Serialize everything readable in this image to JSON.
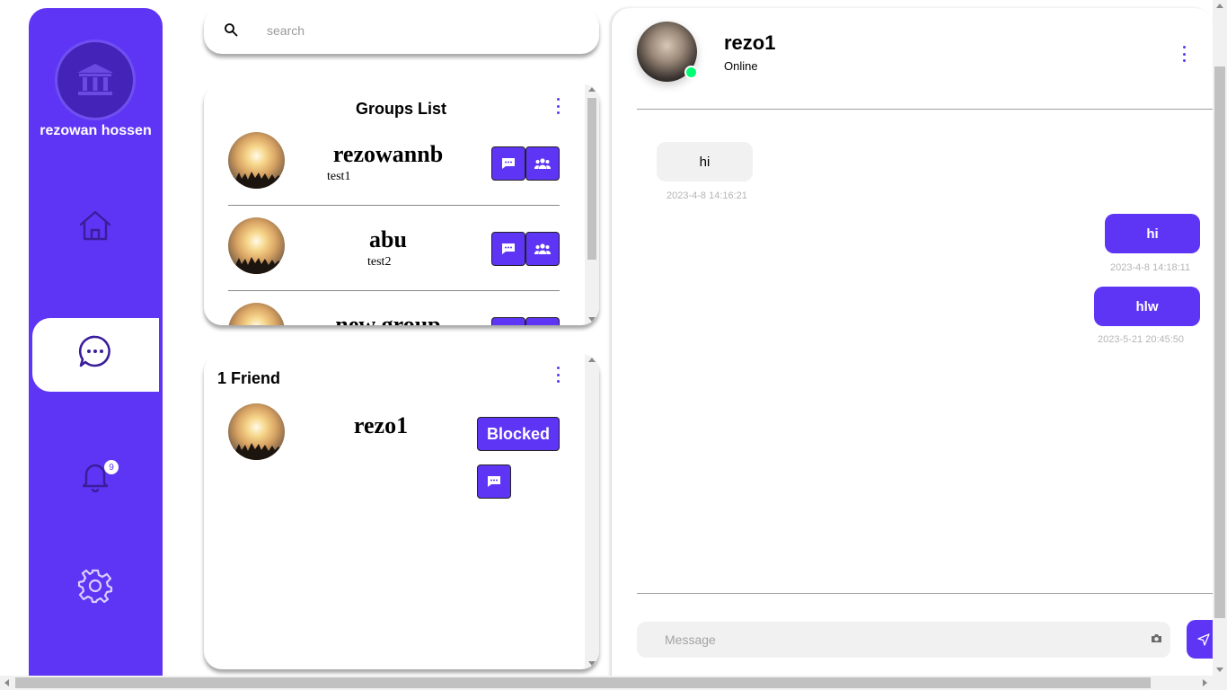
{
  "sidebar": {
    "user_name": "rezowan hossen",
    "avatar_icon": "bank-icon",
    "nav": [
      {
        "name": "home",
        "icon": "home-icon"
      },
      {
        "name": "messages",
        "icon": "chat-bubble-icon",
        "active": true
      },
      {
        "name": "notifications",
        "icon": "bell-icon",
        "badge": "9"
      },
      {
        "name": "settings",
        "icon": "gear-icon"
      }
    ],
    "accent_color": "#5F35F5"
  },
  "search": {
    "placeholder": "search"
  },
  "groups": {
    "title": "Groups List",
    "items": [
      {
        "name": "rezowannb",
        "tag": "test1"
      },
      {
        "name": "abu",
        "tag": "test2"
      },
      {
        "name": "new group",
        "tag": ""
      }
    ]
  },
  "friends": {
    "title": "1 Friend",
    "items": [
      {
        "name": "rezo1",
        "action_label": "Blocked"
      }
    ]
  },
  "chat": {
    "name": "rezo1",
    "status": "Online",
    "messages": [
      {
        "direction": "in",
        "text": "hi",
        "time": "2023-4-8 14:16:21"
      },
      {
        "direction": "out",
        "text": "hi",
        "time": "2023-4-8 14:18:11"
      },
      {
        "direction": "out",
        "text": "hlw",
        "time": "2023-5-21 20:45:50"
      }
    ],
    "input_placeholder": "Message"
  }
}
